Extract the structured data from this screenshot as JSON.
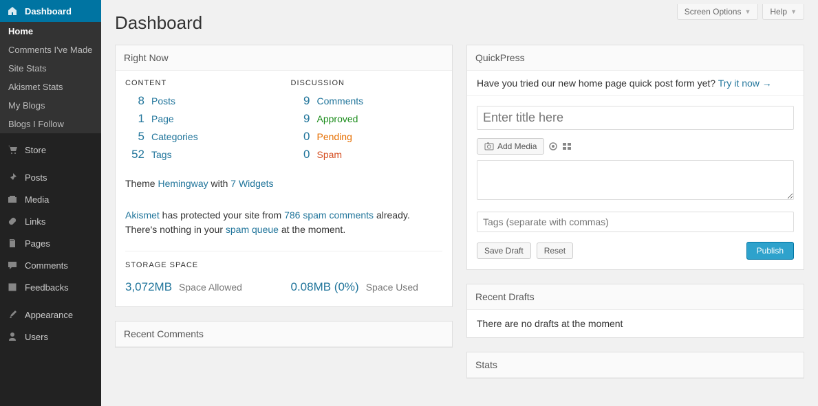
{
  "topTabs": {
    "screenOptions": "Screen Options",
    "help": "Help"
  },
  "sidebar": {
    "dashboard": "Dashboard",
    "subs": [
      "Home",
      "Comments I've Made",
      "Site Stats",
      "Akismet Stats",
      "My Blogs",
      "Blogs I Follow"
    ],
    "items": [
      "Store",
      "Posts",
      "Media",
      "Links",
      "Pages",
      "Comments",
      "Feedbacks",
      "Appearance",
      "Users"
    ]
  },
  "pageTitle": "Dashboard",
  "rightNow": {
    "title": "Right Now",
    "contentHead": "CONTENT",
    "discussionHead": "DISCUSSION",
    "content": [
      {
        "n": "8",
        "label": "Posts"
      },
      {
        "n": "1",
        "label": "Page"
      },
      {
        "n": "5",
        "label": "Categories"
      },
      {
        "n": "52",
        "label": "Tags"
      }
    ],
    "discussion": [
      {
        "n": "9",
        "label": "Comments",
        "cls": "link"
      },
      {
        "n": "9",
        "label": "Approved",
        "cls": "green"
      },
      {
        "n": "0",
        "label": "Pending",
        "cls": "orange"
      },
      {
        "n": "0",
        "label": "Spam",
        "cls": "red"
      }
    ],
    "themePrefix": "Theme ",
    "themeName": "Hemingway",
    "themeMid": " with ",
    "themeWidgets": "7 Widgets",
    "akismet": {
      "a1": "Akismet",
      "t1": " has protected your site from ",
      "a2": "786 spam comments",
      "t2": " already. There's nothing in your ",
      "a3": "spam queue",
      "t3": " at the moment."
    },
    "storageHead": "STORAGE SPACE",
    "storageAllowedNum": "3,072MB",
    "storageAllowedLbl": "Space Allowed",
    "storageUsedNum": "0.08MB (0%)",
    "storageUsedLbl": "Space Used"
  },
  "recentComments": {
    "title": "Recent Comments"
  },
  "quickpress": {
    "title": "QuickPress",
    "note": "Have you tried our new home page quick post form yet? ",
    "noteLink": "Try it now →",
    "titlePlaceholder": "Enter title here",
    "addMedia": "Add Media",
    "tagsPlaceholder": "Tags (separate with commas)",
    "saveDraft": "Save Draft",
    "reset": "Reset",
    "publish": "Publish"
  },
  "recentDrafts": {
    "title": "Recent Drafts",
    "empty": "There are no drafts at the moment"
  },
  "stats": {
    "title": "Stats"
  }
}
